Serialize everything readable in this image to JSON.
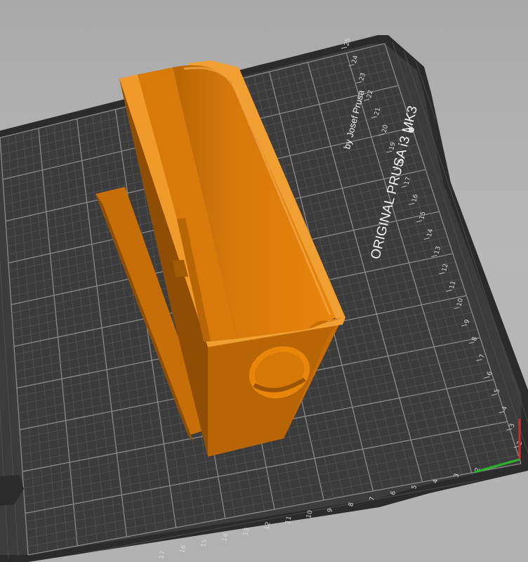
{
  "viewer": {
    "background_color": "#b0b0b0",
    "bed": {
      "plate_color": "#3b3b3b",
      "frame_color": "#2a2a2a",
      "grid_minor_color": "#555555",
      "grid_major_color": "#8a8a8a",
      "printer_title": "ORIGINAL PRUSA i3  MK3",
      "printer_subtitle": "by Josef Prusa",
      "right_ruler_numbers": [
        "25",
        "24",
        "23",
        "22",
        "21",
        "20",
        "19",
        "18",
        "17",
        "16",
        "15",
        "14",
        "13",
        "12",
        "11",
        "10",
        "9",
        "8",
        "7",
        "6",
        "5",
        "4",
        "3",
        "2"
      ],
      "bottom_ruler_numbers": [
        "17",
        "16",
        "15",
        "14",
        "13",
        "12",
        "11",
        "10",
        "9",
        "8",
        "7",
        "6",
        "5",
        "4",
        "3",
        "2"
      ],
      "axis_x_color": "#d12a2a",
      "axis_y_color": "#2bb52b"
    },
    "model": {
      "name": "orange-printed-part",
      "color": "#e8860c",
      "shade_color": "#b86505",
      "dark_color": "#8f4e04"
    }
  }
}
